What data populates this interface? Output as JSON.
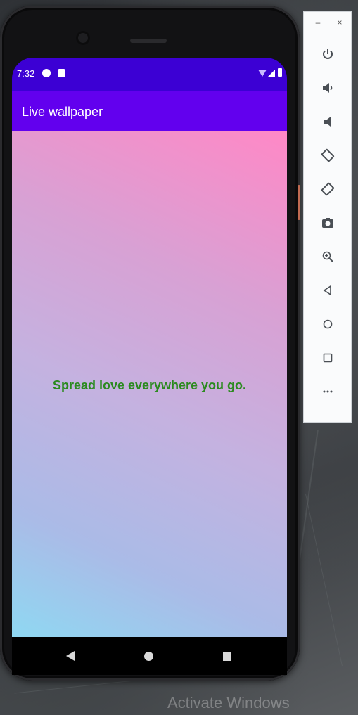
{
  "status_bar": {
    "time": "7:32"
  },
  "app": {
    "title": "Live wallpaper",
    "quote": "Spread love everywhere you go."
  },
  "toolbar": {
    "minimize_label": "–",
    "close_label": "×",
    "buttons": [
      "power-icon",
      "volume-up-icon",
      "volume-down-icon",
      "rotate-left-icon",
      "rotate-right-icon",
      "camera-icon",
      "zoom-icon",
      "back-icon",
      "home-icon",
      "overview-icon",
      "more-icon"
    ]
  },
  "watermark": "Activate Windows",
  "colors": {
    "status_bar": "#3c00d4",
    "app_bar": "#6200ee",
    "quote": "#2b8a1f",
    "gradient_top_right": "#ff88c6",
    "gradient_bottom_left": "#8fd8f2"
  }
}
